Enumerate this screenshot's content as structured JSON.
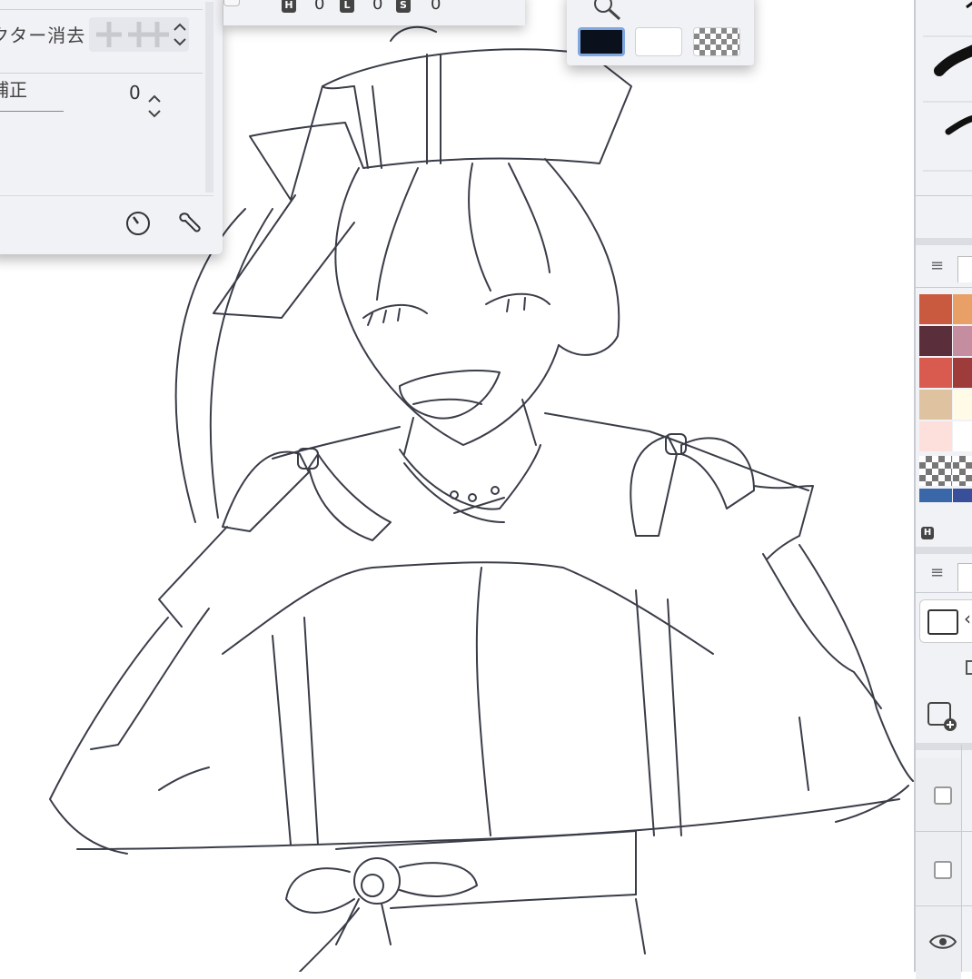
{
  "tool_property": {
    "vector_erase_label": "クター消去",
    "stabilization_label": "補正",
    "stabilization_value": "0"
  },
  "top_toolbar": {
    "btn_h": "H",
    "btn_l": "L",
    "btn_s": "S",
    "value_h": "0",
    "value_l": "0",
    "value_s": "0"
  },
  "color_panel": {
    "main_color": "#0b111c",
    "sub_color": "#ffffff"
  },
  "palette": {
    "colors": [
      "#c95a3f",
      "#e9a067",
      "#5a2e3a",
      "#c48ea0",
      "#d95a4e",
      "#9e3b3b",
      "#dfc3a1",
      "#fffbe6",
      "#fde0dc",
      "#ffffff",
      "#3a67a8",
      "#3a4f9a"
    ],
    "footer_badge": "H"
  },
  "colors": {
    "panel_bg": "#f1f2f6",
    "ink": "#3a3d48"
  }
}
